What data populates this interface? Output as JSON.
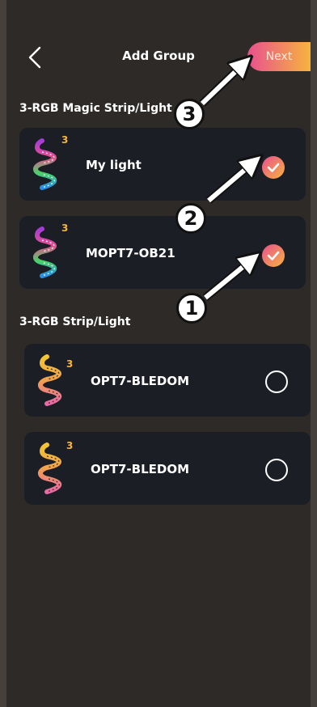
{
  "header": {
    "title": "Add Group",
    "next_label": "Next",
    "back_icon": "chevron-left-icon"
  },
  "sections": [
    {
      "label": "3-RGB Magic Strip/Light",
      "devices": [
        {
          "name": "My light",
          "badge": "3",
          "selected": true
        },
        {
          "name": "MOPT7-OB21",
          "badge": "3",
          "selected": true
        }
      ]
    },
    {
      "label": "3-RGB Strip/Light",
      "devices": [
        {
          "name": "OPT7-BLEDOM",
          "badge": "3",
          "selected": false
        },
        {
          "name": "OPT7-BLEDOM",
          "badge": "3",
          "selected": false
        }
      ]
    }
  ],
  "annotations": {
    "step1": "1",
    "step2": "2",
    "step3": "3"
  },
  "colors": {
    "background": "#2e2a27",
    "card": "#1c1e26",
    "accent_start": "#e8508f",
    "accent_end": "#f7b43e"
  }
}
